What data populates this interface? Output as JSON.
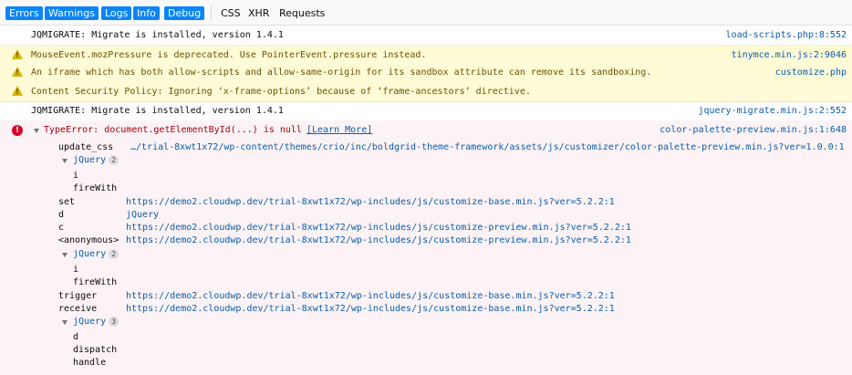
{
  "toolbar": {
    "filters": [
      {
        "label": "Errors",
        "active": true
      },
      {
        "label": "Warnings",
        "active": true
      },
      {
        "label": "Logs",
        "active": true
      },
      {
        "label": "Info",
        "active": true
      },
      {
        "label": "Debug",
        "active": true
      },
      {
        "label": "CSS",
        "active": false
      },
      {
        "label": "XHR",
        "active": false
      },
      {
        "label": "Requests",
        "active": false
      }
    ]
  },
  "messages": [
    {
      "type": "log",
      "text": "JQMIGRATE: Migrate is installed, version 1.4.1",
      "source": "load-scripts.php:8:552"
    },
    {
      "type": "warn",
      "text": "MouseEvent.mozPressure is deprecated. Use PointerEvent.pressure instead.",
      "source": "tinymce.min.js:2:9046"
    },
    {
      "type": "warn",
      "text": "An iframe which has both allow-scripts and allow-same-origin for its sandbox attribute can remove its sandboxing.",
      "source": "customize.php"
    },
    {
      "type": "warn",
      "text": "Content Security Policy: Ignoring ‘x-frame-options’ because of ‘frame-ancestors’ directive.",
      "source": ""
    },
    {
      "type": "log",
      "text": "JQMIGRATE: Migrate is installed, version 1.4.1",
      "source": "jquery-migrate.min.js:2:552"
    }
  ],
  "error": {
    "title": "TypeError: document.getElementById(...) is null",
    "learn_more": "[Learn More]",
    "source": "color-palette-preview.min.js:1:648",
    "stack": {
      "update_css": {
        "fn": "update_css",
        "loc": "…/trial-8xwt1x72/wp-content/themes/crio/inc/boldgrid-theme-framework/assets/js/customizer/color-palette-preview.min.js?ver=1.0.0:1"
      },
      "group1": {
        "label": "jQuery",
        "count": "2",
        "items": [
          "i",
          "fireWith"
        ]
      },
      "set": {
        "fn": "set",
        "loc": "https://demo2.cloudwp.dev/trial-8xwt1x72/wp-includes/js/customize-base.min.js?ver=5.2.2:1"
      },
      "d": {
        "fn": "d",
        "loc": "jQuery"
      },
      "c": {
        "fn": "c",
        "loc": "https://demo2.cloudwp.dev/trial-8xwt1x72/wp-includes/js/customize-preview.min.js?ver=5.2.2:1"
      },
      "anonymous": {
        "fn": "<anonymous>",
        "loc": "https://demo2.cloudwp.dev/trial-8xwt1x72/wp-includes/js/customize-preview.min.js?ver=5.2.2:1"
      },
      "group2": {
        "label": "jQuery",
        "count": "2",
        "items": [
          "i",
          "fireWith"
        ]
      },
      "trigger": {
        "fn": "trigger",
        "loc": "https://demo2.cloudwp.dev/trial-8xwt1x72/wp-includes/js/customize-base.min.js?ver=5.2.2:1"
      },
      "receive": {
        "fn": "receive",
        "loc": "https://demo2.cloudwp.dev/trial-8xwt1x72/wp-includes/js/customize-base.min.js?ver=5.2.2:1"
      },
      "group3": {
        "label": "jQuery",
        "count": "3",
        "items": [
          "d",
          "dispatch",
          "handle"
        ]
      }
    }
  }
}
